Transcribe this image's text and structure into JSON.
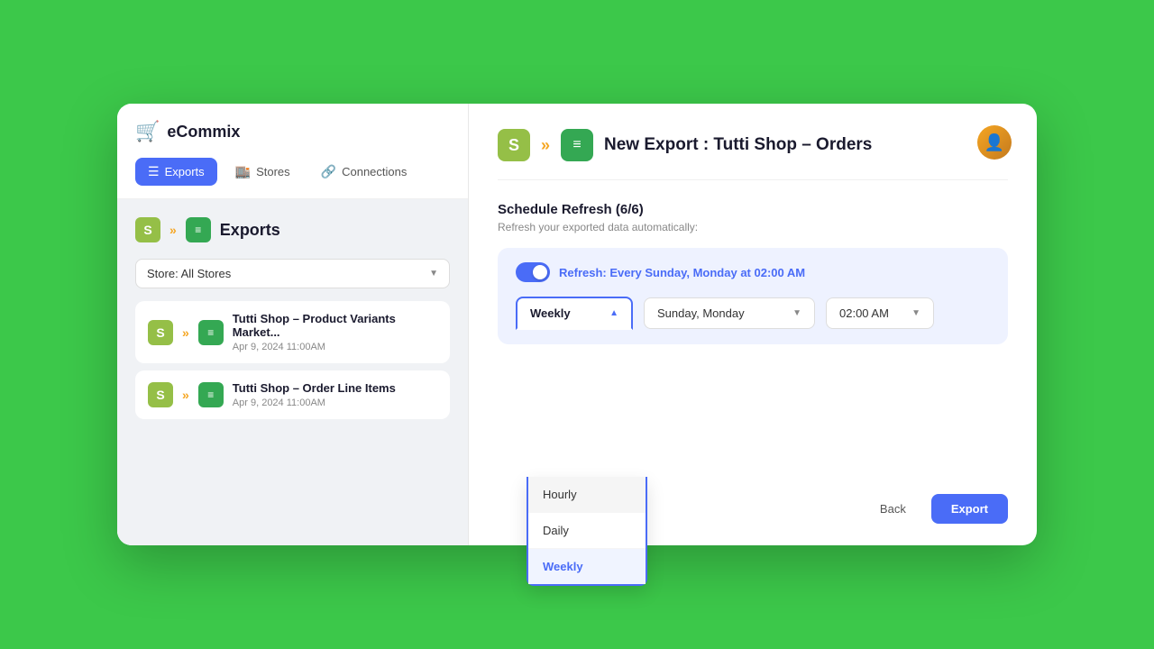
{
  "app": {
    "name": "eCommix",
    "logo_unicode": "🛒"
  },
  "header": {
    "avatar_label": "User Avatar"
  },
  "nav": {
    "tabs": [
      {
        "id": "exports",
        "label": "Exports",
        "active": true,
        "icon": "☰"
      },
      {
        "id": "stores",
        "label": "Stores",
        "active": false,
        "icon": "🏬"
      },
      {
        "id": "connections",
        "label": "Connections",
        "active": false,
        "icon": "🔗"
      }
    ]
  },
  "sidebar": {
    "exports_title": "Exports",
    "store_filter": "Store: All Stores",
    "items": [
      {
        "name": "Tutti Shop – Product Variants Market...",
        "date": "Apr 9, 2024 11:00AM"
      },
      {
        "name": "Tutti Shop – Order Line Items",
        "date": "Apr 9, 2024 11:00AM"
      }
    ]
  },
  "export_panel": {
    "title": "New Export : Tutti Shop – Orders",
    "step_label": "Schedule Refresh (6/6)",
    "step_subtitle": "Refresh your exported data automatically:",
    "refresh_text": "Refresh: Every Sunday, Monday at 02:00 AM",
    "frequency_dropdown": {
      "selected": "Weekly",
      "options": [
        "Hourly",
        "Daily",
        "Weekly"
      ]
    },
    "days_dropdown": {
      "selected": "Sunday, Monday"
    },
    "time_dropdown": {
      "selected": "02:00 AM"
    },
    "back_label": "Back",
    "export_label": "Export"
  }
}
